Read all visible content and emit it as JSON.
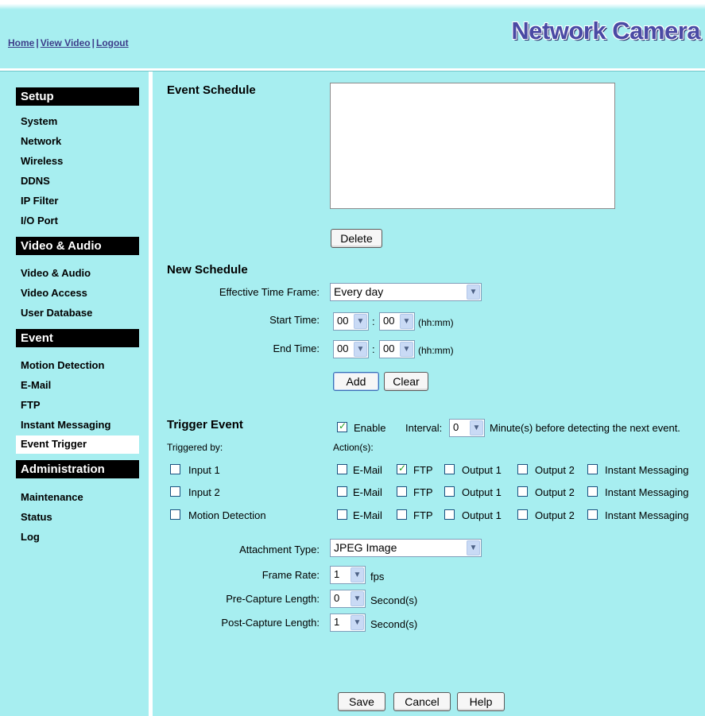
{
  "header": {
    "nav": [
      "Home",
      "View Video",
      "Logout"
    ],
    "logo": "Network Camera"
  },
  "sidebar": {
    "sections": [
      {
        "title": "Setup",
        "items": [
          "System",
          "Network",
          "Wireless",
          "DDNS",
          "IP Filter",
          "I/O Port"
        ]
      },
      {
        "title": "Video & Audio",
        "items": [
          "Video & Audio",
          "Video Access",
          "User Database"
        ]
      },
      {
        "title": "Event",
        "items": [
          "Motion Detection",
          "E-Mail",
          "FTP",
          "Instant Messaging",
          "Event Trigger"
        ]
      },
      {
        "title": "Administration",
        "items": [
          "Maintenance",
          "Status",
          "Log"
        ]
      }
    ],
    "active_item": "Event Trigger"
  },
  "event_schedule": {
    "title": "Event Schedule",
    "delete_label": "Delete"
  },
  "new_schedule": {
    "title": "New Schedule",
    "time_frame_label": "Effective Time Frame:",
    "time_frame_value": "Every day",
    "start_label": "Start Time:",
    "start_hh": "00",
    "start_mm": "00",
    "end_label": "End Time:",
    "end_hh": "00",
    "end_mm": "00",
    "colon": ":",
    "hhmm": "(hh:mm)",
    "add_label": "Add",
    "clear_label": "Clear"
  },
  "trigger_event": {
    "title": "Trigger Event",
    "enable_label": "Enable",
    "enable_checked": true,
    "interval_label": "Interval:",
    "interval_value": "0",
    "interval_suffix": "Minute(s) before detecting the next event.",
    "triggered_by_label": "Triggered by:",
    "actions_label": "Action(s):",
    "action_names": [
      "E-Mail",
      "FTP",
      "Output 1",
      "Output 2",
      "Instant Messaging"
    ],
    "rows": [
      {
        "trigger": "Input 1",
        "trigger_checked": false,
        "actions_checked": [
          false,
          true,
          false,
          false,
          false
        ]
      },
      {
        "trigger": "Input 2",
        "trigger_checked": false,
        "actions_checked": [
          false,
          false,
          false,
          false,
          false
        ]
      },
      {
        "trigger": "Motion Detection",
        "trigger_checked": false,
        "actions_checked": [
          false,
          false,
          false,
          false,
          false
        ]
      }
    ]
  },
  "attachment": {
    "type_label": "Attachment Type:",
    "type_value": "JPEG Image",
    "frame_rate_label": "Frame Rate:",
    "frame_rate_value": "1",
    "frame_rate_unit": "fps",
    "pre_label": "Pre-Capture Length:",
    "pre_value": "0",
    "post_label": "Post-Capture Length:",
    "post_value": "1",
    "seconds_unit": "Second(s)"
  },
  "footer": {
    "save_label": "Save",
    "cancel_label": "Cancel",
    "help_label": "Help"
  }
}
